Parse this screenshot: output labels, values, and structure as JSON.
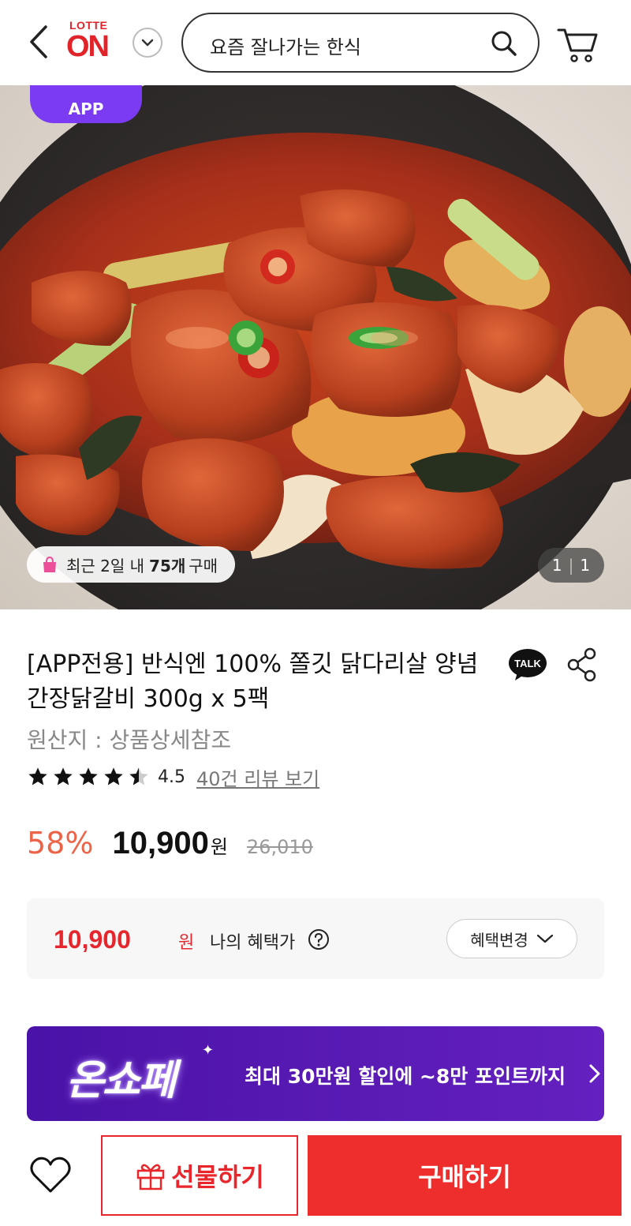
{
  "header": {
    "logo_top": "LOTTE",
    "logo_main": "ON",
    "search_placeholder": "요즘 잘나가는 한식"
  },
  "hero": {
    "badge": "APP",
    "recent_purchase": {
      "prefix": "최근 2일 내",
      "count": "75개",
      "suffix": "구매"
    },
    "pager": {
      "current": "1",
      "total": "1"
    }
  },
  "product": {
    "title": "[APP전용] 반식엔 100% 쫄깃 닭다리살 양념 간장닭갈비 300g x 5팩",
    "origin": "원산지 : 상품상세참조",
    "rating": 4.5,
    "rating_text": "4.5",
    "review_link": "40건 리뷰 보기",
    "discount": "58%",
    "price": "10,900",
    "price_unit": "원",
    "original_price": "26,010"
  },
  "benefit": {
    "price": "10,900",
    "unit": "원",
    "label": "나의 혜택가",
    "change_button": "혜택변경"
  },
  "banner": {
    "brand": "온쇼페",
    "message": "최대 30만원 할인에 ~8만 포인트까지"
  },
  "actions": {
    "gift": "선물하기",
    "buy": "구매하기"
  },
  "colors": {
    "brand_red": "#e0242a",
    "discount": "#ec6448",
    "benefit_price": "#e6262d",
    "banner_purple": "#5a1bb5",
    "app_badge": "#7b3bf2"
  }
}
